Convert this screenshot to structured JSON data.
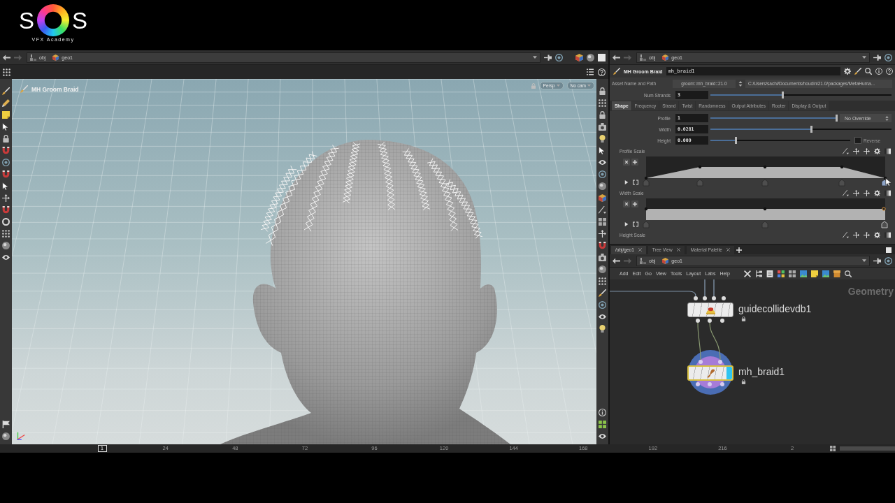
{
  "logo": {
    "left_letter": "S",
    "right_letter": "S",
    "tagline": "VFX Academy"
  },
  "viewer": {
    "path": [
      "obj",
      "geo1"
    ],
    "tool_label": "MH Groom Braid",
    "view_menus": [
      "Persp",
      "No cam"
    ]
  },
  "parameters": {
    "path": [
      "obj",
      "geo1"
    ],
    "node_type": "MH Groom Braid",
    "node_name": "mh_braid1",
    "asset_label": "Asset Name and Path",
    "asset_name": "groom::mh_braid::21.0",
    "asset_path": "C:/Users/sachi/Documents/houdini21.0/packages/MetaHuma...",
    "num_strands": {
      "label": "Num Strands",
      "value": "3",
      "level": 0.4
    },
    "tabs": [
      {
        "label": "Shape",
        "selected": true
      },
      {
        "label": "Frequency",
        "selected": false
      },
      {
        "label": "Strand",
        "selected": false
      },
      {
        "label": "Twist",
        "selected": false
      },
      {
        "label": "Randomness",
        "selected": false
      },
      {
        "label": "Output Attributes",
        "selected": false
      },
      {
        "label": "Rooter",
        "selected": false
      },
      {
        "label": "Display & Output",
        "selected": false
      }
    ],
    "fields": [
      {
        "label": "Profile",
        "value": "1",
        "level": 1,
        "kind": "menu",
        "menu": "No Override"
      },
      {
        "label": "Width",
        "value": "0.0281",
        "level": 0.56,
        "kind": "slider"
      },
      {
        "label": "Height",
        "value": "0.009",
        "level": 0.18,
        "kind": "toggle",
        "toggle_label": "Reverse",
        "checked": false
      }
    ],
    "ramps": [
      {
        "label": "Profile Scale",
        "kind": "taper"
      },
      {
        "label": "Width Scale",
        "kind": "flat"
      },
      {
        "label": "Height Scale",
        "kind": "cut"
      }
    ]
  },
  "network": {
    "pane_tabs": [
      {
        "label": "/obj/geo1",
        "selected": true
      },
      {
        "label": "Tree View",
        "selected": false
      },
      {
        "label": "Material Palette",
        "selected": false
      }
    ],
    "path": [
      "obj",
      "geo1"
    ],
    "menu": [
      "Add",
      "Edit",
      "Go",
      "View",
      "Tools",
      "Layout",
      "Labs",
      "Help"
    ],
    "context_label": "Geometry",
    "nodes": [
      {
        "name": "guidecollidevdb1",
        "selected": false,
        "display": false
      },
      {
        "name": "mh_braid1",
        "selected": true,
        "display": true
      }
    ]
  },
  "timeline": {
    "frame": "1",
    "ticks": [
      "24",
      "48",
      "72",
      "96",
      "120",
      "144",
      "168",
      "192",
      "216",
      "2"
    ]
  }
}
